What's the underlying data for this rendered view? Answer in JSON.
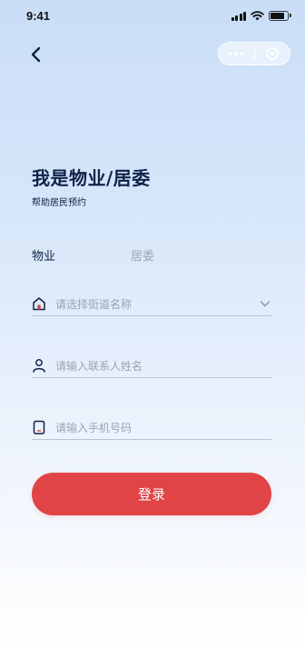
{
  "status_bar": {
    "time": "9:41",
    "battery_level": 0.85
  },
  "header": {
    "title": "我是物业/居委",
    "subtitle": "帮助居民预约"
  },
  "tabs": [
    {
      "label": "物业",
      "active": true
    },
    {
      "label": "居委",
      "active": false
    }
  ],
  "form": {
    "street": {
      "placeholder": "请选择街道名称",
      "icon": "home-icon"
    },
    "name": {
      "placeholder": "请输入联系人姓名",
      "icon": "user-icon"
    },
    "phone": {
      "placeholder": "请输入手机号码",
      "icon": "phone-icon"
    }
  },
  "login_button": {
    "label": "登录"
  },
  "colors": {
    "primary": "#e04446",
    "title": "#0f2347",
    "inactive": "#9aa6b6",
    "home_icon_accent": "#d9434a"
  }
}
